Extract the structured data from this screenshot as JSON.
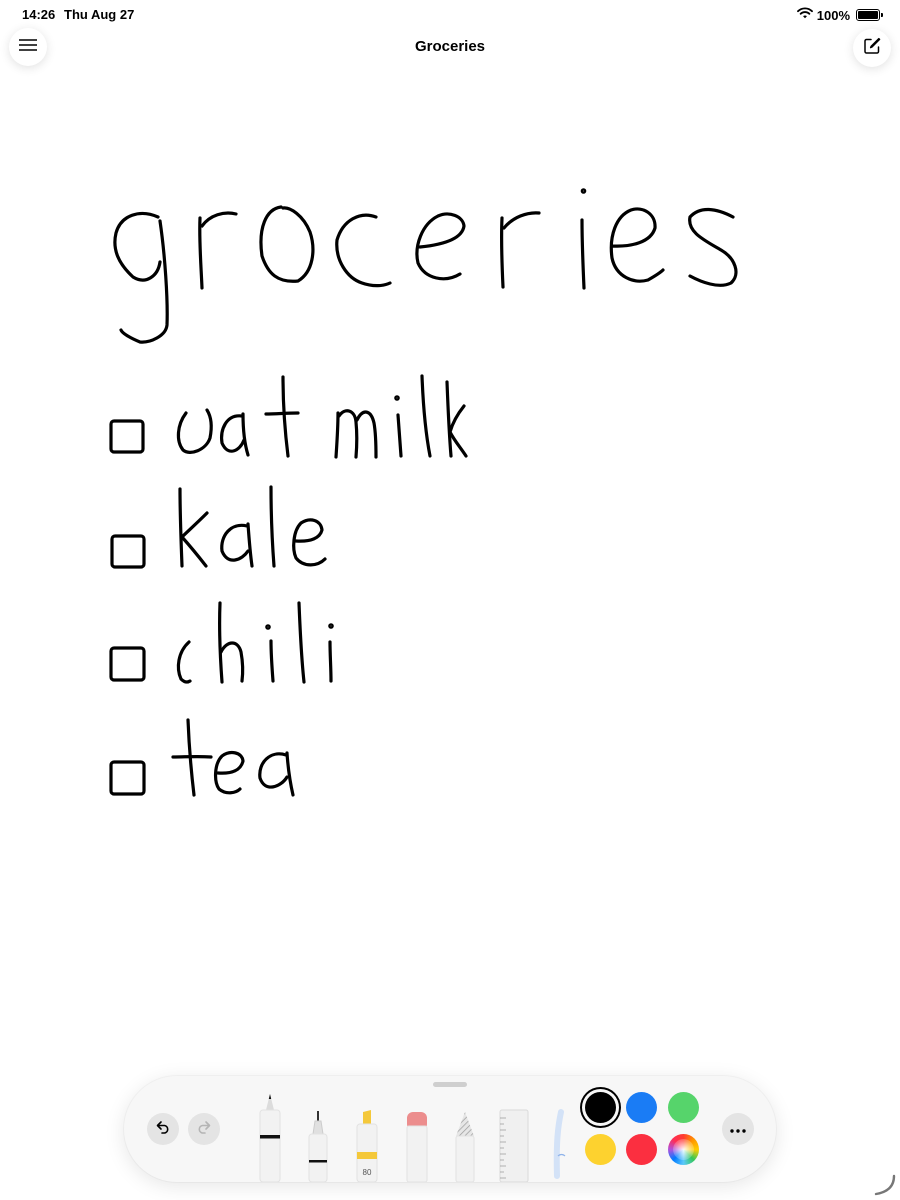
{
  "status_bar": {
    "time": "14:26",
    "date": "Thu Aug 27",
    "battery": "100%"
  },
  "header": {
    "title": "Groceries",
    "menu_icon": "hamburger-menu-icon",
    "compose_icon": "compose-icon"
  },
  "note": {
    "handwritten_title": "groceries",
    "items": [
      {
        "text": "oat milk",
        "checked": false
      },
      {
        "text": "kale",
        "checked": false
      },
      {
        "text": "chili",
        "checked": false
      },
      {
        "text": "tea",
        "checked": false
      }
    ]
  },
  "palette": {
    "undo_icon": "undo-icon",
    "redo_icon": "redo-icon",
    "more_icon": "ellipsis-icon",
    "tools": [
      "pen",
      "fineliner",
      "highlighter",
      "eraser",
      "pencil",
      "ruler",
      "lasso"
    ],
    "highlighter_size": "80",
    "colors": [
      {
        "name": "black",
        "hex": "#000000",
        "selected": true
      },
      {
        "name": "blue",
        "hex": "#1a7cf5",
        "selected": false
      },
      {
        "name": "green",
        "hex": "#56d46b",
        "selected": false
      },
      {
        "name": "yellow",
        "hex": "#fdd22f",
        "selected": false
      },
      {
        "name": "red",
        "hex": "#fb2f40",
        "selected": false
      },
      {
        "name": "color-picker",
        "hex": "multicolor",
        "selected": false
      }
    ]
  }
}
